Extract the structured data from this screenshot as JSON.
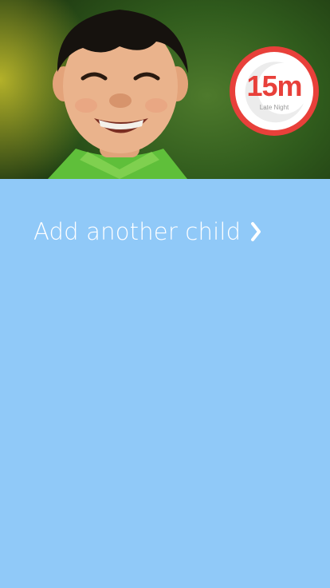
{
  "hero": {
    "photo_description_icon": "child-photo"
  },
  "timer": {
    "value": "15m",
    "label": "Late Night",
    "ring_color": "#e8403a",
    "icon": "moon-icon"
  },
  "add_child": {
    "label": "Add another child",
    "icon": "chevron-right-icon"
  },
  "theme": {
    "background": "#90c9f8",
    "text": "#ffffff"
  }
}
